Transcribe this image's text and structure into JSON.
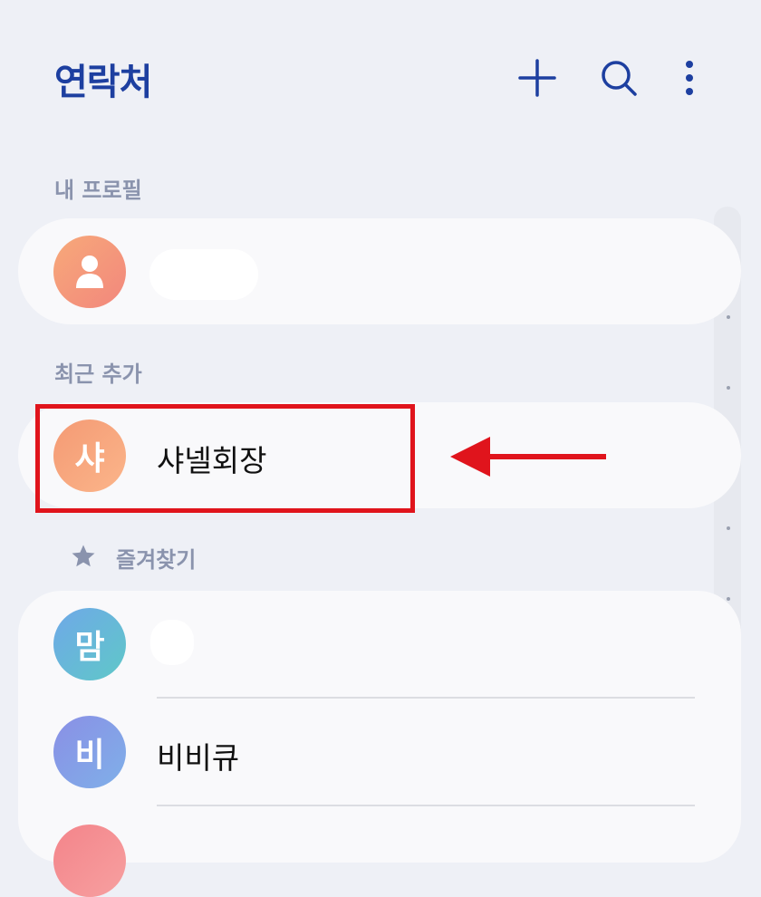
{
  "header": {
    "title": "연락처",
    "add_label": "add contact",
    "search_label": "search",
    "more_label": "more options"
  },
  "sections": {
    "my_profile": "내 프로필",
    "recently_added": "최근 추가",
    "favorites": "즐겨찾기"
  },
  "recent": {
    "avatar_initial": "샤",
    "name": "샤넬회장"
  },
  "favorites": [
    {
      "avatar_initial": "맘",
      "name": ""
    },
    {
      "avatar_initial": "비",
      "name": "비비큐"
    }
  ],
  "colors": {
    "accent": "#1d3fa0",
    "annotation_red": "#e0141c",
    "avatar_orange": "#f59b76",
    "avatar_teal": "#5fb6d6",
    "avatar_purple": "#7f8fe0"
  }
}
